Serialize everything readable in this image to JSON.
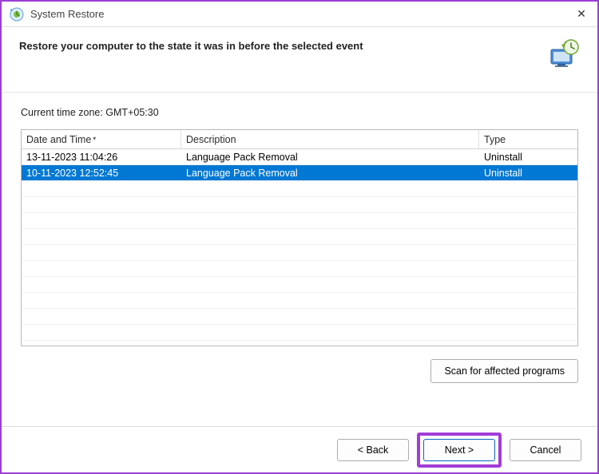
{
  "titlebar": {
    "title": "System Restore",
    "close_label": "✕"
  },
  "header": {
    "instruction": "Restore your computer to the state it was in before the selected event"
  },
  "timezone": {
    "label": "Current time zone: GMT+05:30"
  },
  "table": {
    "columns": {
      "date": "Date and Time",
      "description": "Description",
      "type": "Type"
    },
    "rows": [
      {
        "date": "13-11-2023 11:04:26",
        "description": "Language Pack Removal",
        "type": "Uninstall",
        "selected": false
      },
      {
        "date": "10-11-2023 12:52:45",
        "description": "Language Pack Removal",
        "type": "Uninstall",
        "selected": true
      }
    ]
  },
  "buttons": {
    "scan": "Scan for affected programs",
    "back": "< Back",
    "next": "Next >",
    "cancel": "Cancel"
  }
}
